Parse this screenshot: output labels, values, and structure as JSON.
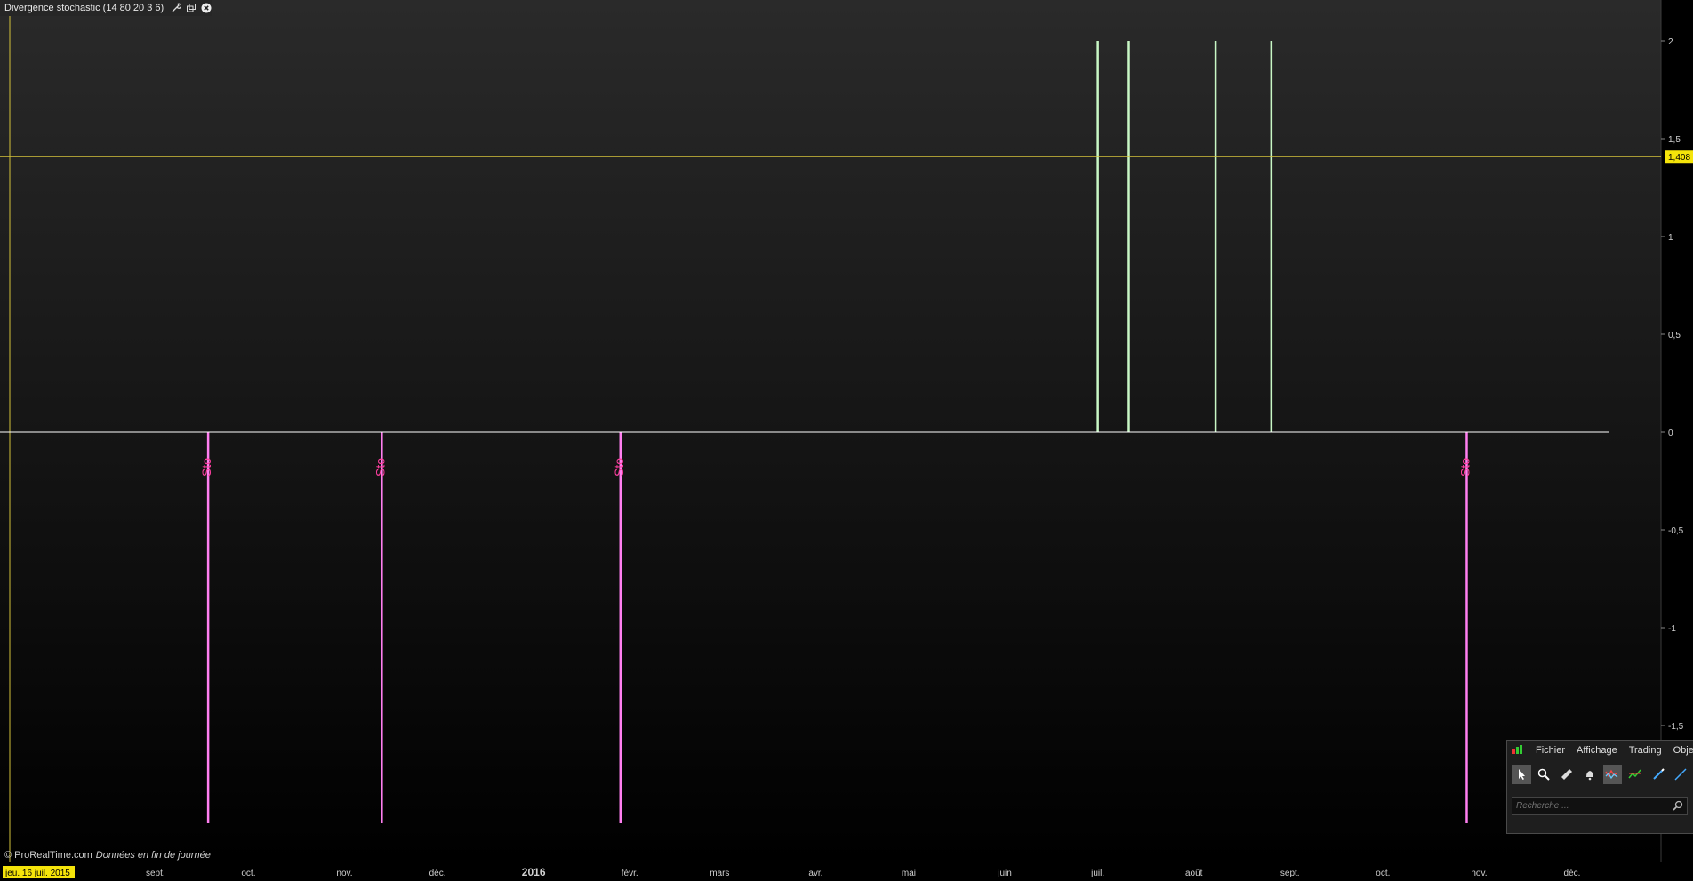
{
  "window": {
    "title": "Divergence stochastic (14 80 20 3 6)"
  },
  "chart_data": {
    "type": "bar",
    "title": "",
    "ylim": [
      -1.95,
      2.1
    ],
    "y_ticks": [
      {
        "value": 2,
        "label": "2"
      },
      {
        "value": 1.5,
        "label": "1,5"
      },
      {
        "value": 1,
        "label": "1"
      },
      {
        "value": 0.5,
        "label": "0,5"
      },
      {
        "value": 0,
        "label": "0"
      },
      {
        "value": -0.5,
        "label": "-0,5"
      },
      {
        "value": -1,
        "label": "-1"
      },
      {
        "value": -1.5,
        "label": "-1,5"
      }
    ],
    "x_range": [
      "2015-07-16",
      "2016-12-31"
    ],
    "x_ticks": [
      {
        "date": "2015-09-01",
        "label": "sept."
      },
      {
        "date": "2015-10-01",
        "label": "oct."
      },
      {
        "date": "2015-11-01",
        "label": "nov."
      },
      {
        "date": "2015-12-01",
        "label": "déc."
      },
      {
        "date": "2016-01-01",
        "label": "2016",
        "bold": true
      },
      {
        "date": "2016-02-01",
        "label": "févr."
      },
      {
        "date": "2016-03-01",
        "label": "mars"
      },
      {
        "date": "2016-04-01",
        "label": "avr."
      },
      {
        "date": "2016-05-01",
        "label": "mai"
      },
      {
        "date": "2016-06-01",
        "label": "juin"
      },
      {
        "date": "2016-07-01",
        "label": "juil."
      },
      {
        "date": "2016-08-01",
        "label": "août"
      },
      {
        "date": "2016-09-01",
        "label": "sept."
      },
      {
        "date": "2016-10-01",
        "label": "oct."
      },
      {
        "date": "2016-11-01",
        "label": "nov."
      },
      {
        "date": "2016-12-01",
        "label": "déc."
      }
    ],
    "cursor_label": "jeu. 16 juil. 2015",
    "series": [
      {
        "color": "#c8f7c5",
        "points": [
          {
            "date": "2016-07-01",
            "value": 2
          },
          {
            "date": "2016-07-11",
            "value": 2
          },
          {
            "date": "2016-08-08",
            "value": 2
          },
          {
            "date": "2016-08-26",
            "value": 2
          }
        ]
      },
      {
        "color": "#ff7ff0",
        "points": [
          {
            "date": "2015-09-18",
            "value": -2
          },
          {
            "date": "2015-11-13",
            "value": -2
          },
          {
            "date": "2016-01-29",
            "value": -2
          },
          {
            "date": "2016-10-28",
            "value": -2
          }
        ]
      }
    ],
    "annotations": [
      {
        "date": "2015-09-18",
        "text": "Sto",
        "color": "#ff3fa0"
      },
      {
        "date": "2015-11-13",
        "text": "Sto",
        "color": "#ff3fa0"
      },
      {
        "date": "2016-01-29",
        "text": "Sto",
        "color": "#ff3fa0"
      },
      {
        "date": "2016-10-28",
        "text": "Sto",
        "color": "#ff3fa0"
      }
    ],
    "zero_line": {
      "value": 0,
      "color": "#ffffff"
    },
    "reference_line": {
      "value": 1.408,
      "label": "1,408",
      "color": "#d4c23a"
    },
    "grid": false
  },
  "footer": {
    "copyright": "© ProRealTime.com",
    "note": "Données en fin de journée"
  },
  "toolbar": {
    "menus": [
      "Fichier",
      "Affichage",
      "Trading",
      "Objets"
    ],
    "tools": [
      "pointer-icon",
      "zoom-icon",
      "ruler-icon",
      "alert-bell-icon",
      "indicator-icon",
      "trend-icon",
      "pen-icon",
      "line-icon"
    ],
    "search_placeholder": "Recherche ..."
  },
  "colors": {
    "plot_bg_top": "#2a2a2a",
    "plot_bg_bottom": "#000000",
    "yellow_line": "#d4c23a",
    "green_bars": "#c8f7c5",
    "pink_bars": "#ff7ff0",
    "label_magenta": "#ff3fa0",
    "yellow_highlight": "#f5e40a"
  }
}
